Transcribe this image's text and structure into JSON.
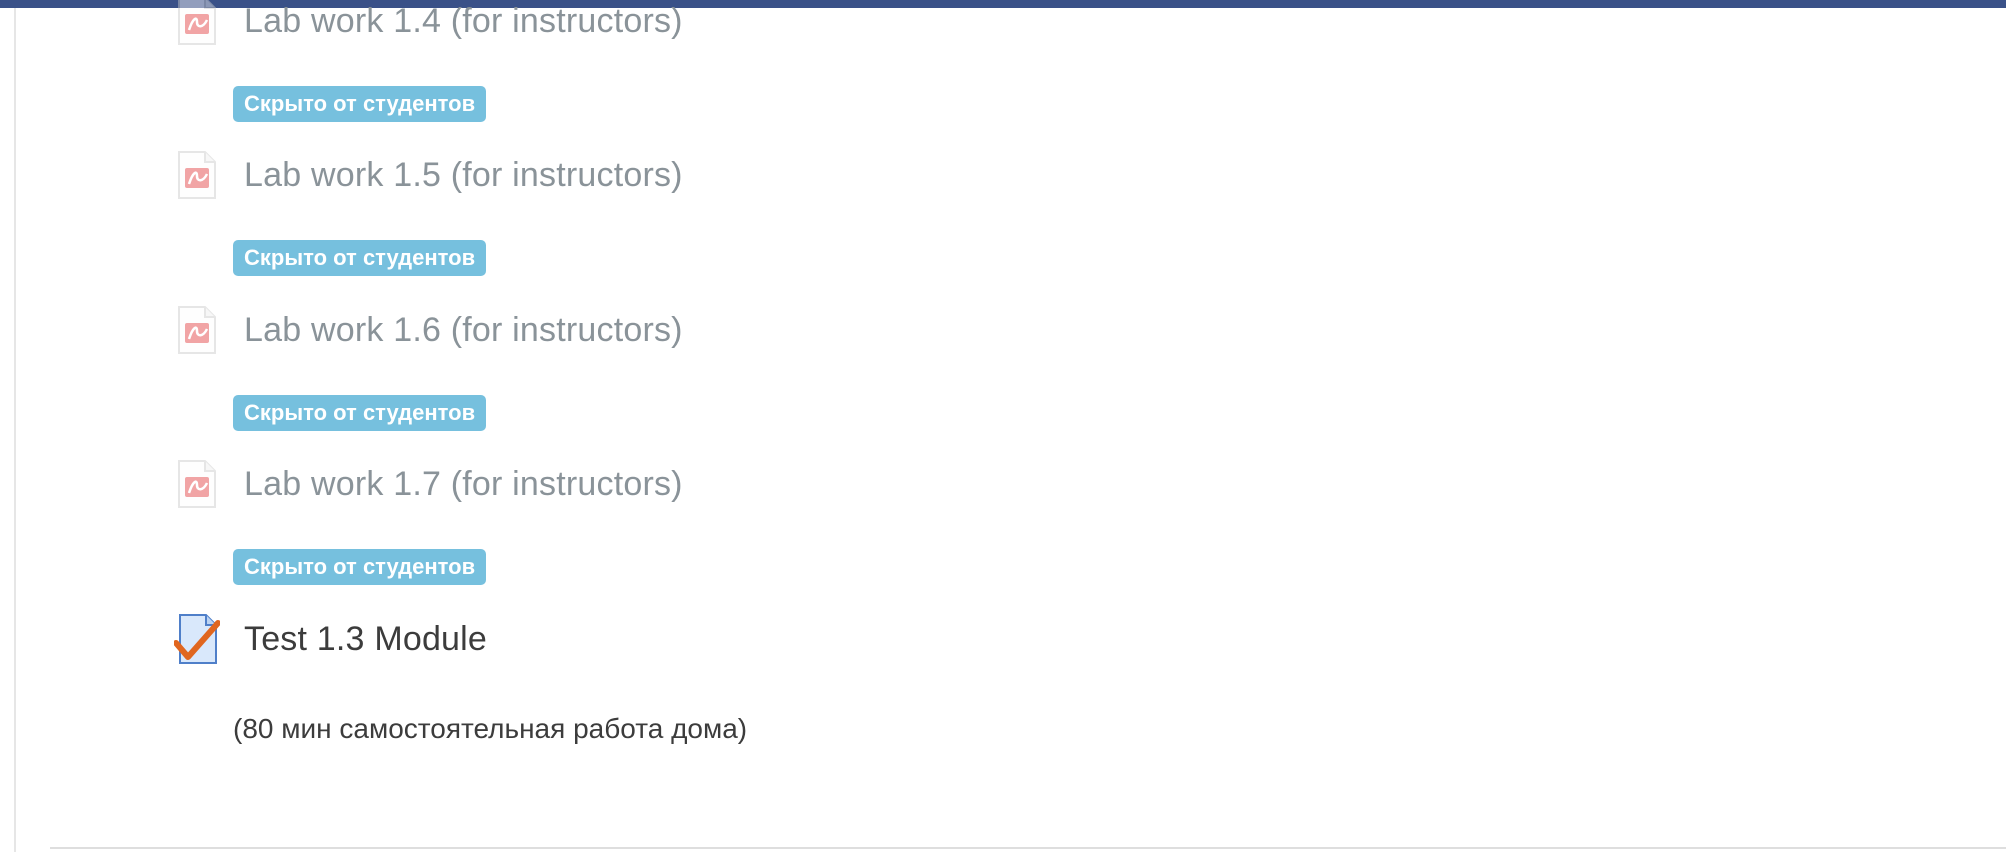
{
  "colors": {
    "top_bar": "#3a5188",
    "badge_bg": "#76c0de",
    "dimmed_text": "#8a9399",
    "normal_text": "#3c3c3c"
  },
  "activities": [
    {
      "title": "Lab work 1.4 (for instructors)",
      "icon": "pdf-file-icon",
      "badge": "Скрыто от студентов"
    },
    {
      "title": "Lab work 1.5 (for instructors)",
      "icon": "pdf-file-icon",
      "badge": "Скрыто от студентов"
    },
    {
      "title": "Lab work 1.6 (for instructors)",
      "icon": "pdf-file-icon",
      "badge": "Скрыто от студентов"
    },
    {
      "title": "Lab work 1.7 (for instructors)",
      "icon": "pdf-file-icon",
      "badge": "Скрыто от студентов"
    }
  ],
  "quiz": {
    "title": "Test 1.3 Module",
    "icon": "quiz-checkmark-icon",
    "note": "(80 мин самостоятельная работа дома)"
  }
}
